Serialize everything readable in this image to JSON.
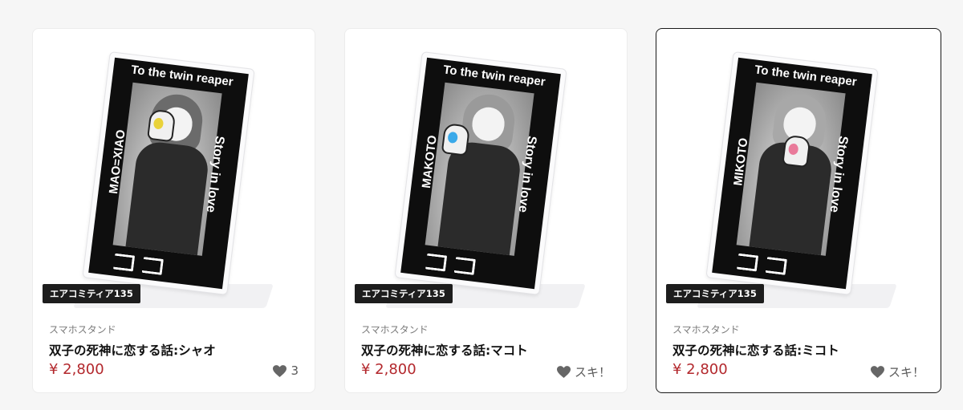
{
  "products": [
    {
      "artwork": {
        "top_text": "To the twin reaper",
        "left_text": "MAO=XIAO",
        "right_text": "Story in love",
        "eye_color": "#e9d23a"
      },
      "event_tag": "エアコミティア135",
      "category": "スマホスタンド",
      "name": "双子の死神に恋する話:シャオ",
      "price": "¥ 2,800",
      "like_label": "3",
      "like_icon": "heart-icon"
    },
    {
      "artwork": {
        "top_text": "To the twin reaper",
        "left_text": "MAKOTO",
        "right_text": "Story in love",
        "eye_color": "#3aa9e9"
      },
      "event_tag": "エアコミティア135",
      "category": "スマホスタンド",
      "name": "双子の死神に恋する話:マコト",
      "price": "¥ 2,800",
      "like_label": "スキ！",
      "like_icon": "heart-icon"
    },
    {
      "artwork": {
        "top_text": "To the twin reaper",
        "left_text": "MIKOTO",
        "right_text": "Story in love",
        "eye_color": "#e97a9a"
      },
      "event_tag": "エアコミティア135",
      "category": "スマホスタンド",
      "name": "双子の死神に恋する話:ミコト",
      "price": "¥ 2,800",
      "like_label": "スキ！",
      "like_icon": "heart-icon"
    }
  ],
  "colors": {
    "price": "#b3282d",
    "tag_bg": "#1d1d1d",
    "selected_border": "#1a1a1a"
  }
}
